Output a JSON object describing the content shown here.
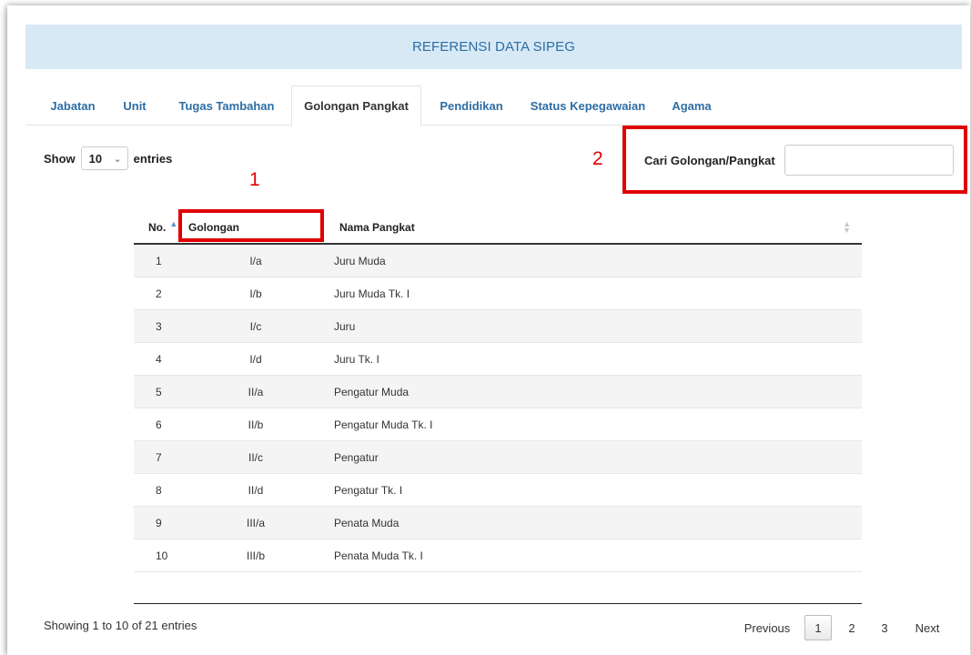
{
  "header": {
    "title": "REFERENSI DATA SIPEG"
  },
  "tabs": [
    {
      "label": "Jabatan"
    },
    {
      "label": "Unit"
    },
    {
      "label": "Tugas Tambahan"
    },
    {
      "label": "Golongan Pangkat"
    },
    {
      "label": "Pendidikan"
    },
    {
      "label": "Status Kepegawaian"
    },
    {
      "label": "Agama"
    }
  ],
  "active_tab": "Golongan Pangkat",
  "length_menu": {
    "prefix": "Show",
    "value": "10",
    "suffix": "entries"
  },
  "search": {
    "label": "Cari Golongan/Pangkat",
    "value": "",
    "placeholder": ""
  },
  "annotations": [
    {
      "number": "1",
      "color": "#e00000"
    },
    {
      "number": "2",
      "color": "#e00000"
    }
  ],
  "table": {
    "columns": [
      {
        "label": "No.",
        "sort": "asc"
      },
      {
        "label": "Golongan",
        "sort": "none"
      },
      {
        "label": "Nama Pangkat",
        "sort": "none"
      }
    ],
    "rows": [
      [
        "1",
        "I/a",
        "Juru Muda"
      ],
      [
        "2",
        "I/b",
        "Juru Muda Tk. I"
      ],
      [
        "3",
        "I/c",
        "Juru"
      ],
      [
        "4",
        "I/d",
        "Juru Tk. I"
      ],
      [
        "5",
        "II/a",
        "Pengatur Muda"
      ],
      [
        "6",
        "II/b",
        "Pengatur Muda Tk. I"
      ],
      [
        "7",
        "II/c",
        "Pengatur"
      ],
      [
        "8",
        "II/d",
        "Pengatur Tk. I"
      ],
      [
        "9",
        "III/a",
        "Penata Muda"
      ],
      [
        "10",
        "III/b",
        "Penata Muda Tk. I"
      ]
    ]
  },
  "footer": {
    "info": "Showing 1 to 10 of 21 entries",
    "pagination": {
      "previous": "Previous",
      "pages": [
        "1",
        "2",
        "3"
      ],
      "current": "1",
      "next": "Next"
    }
  },
  "colors": {
    "accent": "#2e6da4",
    "header_bg": "#d6e9f5",
    "annotation": "#e00000"
  }
}
